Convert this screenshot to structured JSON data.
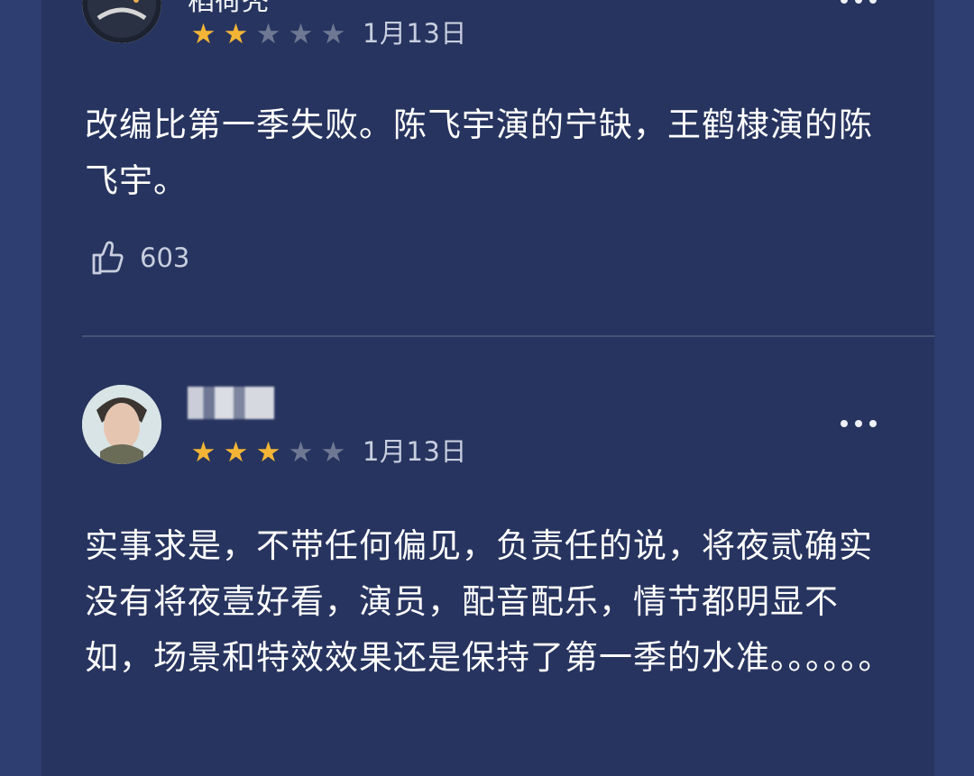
{
  "reviews": [
    {
      "username": "稻荷秃",
      "rating": 2,
      "date": "1月13日",
      "content": "改编比第一季失败。陈飞宇演的宁缺，王鹤棣演的陈飞宇。",
      "likes": "603"
    },
    {
      "rating": 3,
      "date": "1月13日",
      "content": "实事求是，不带任何偏见，负责任的说，将夜贰确实没有将夜壹好看，演员，配音配乐，情节都明显不如，场景和特效效果还是保持了第一季的水准。。。。。。"
    }
  ],
  "colors": {
    "background": "#2f3e70",
    "panel": "#27345f",
    "star_filled": "#f4b536",
    "star_empty": "#6f7893",
    "muted_text": "#c8cedf"
  },
  "icons": {
    "more": "more-options-icon",
    "like": "thumbs-up-icon"
  }
}
